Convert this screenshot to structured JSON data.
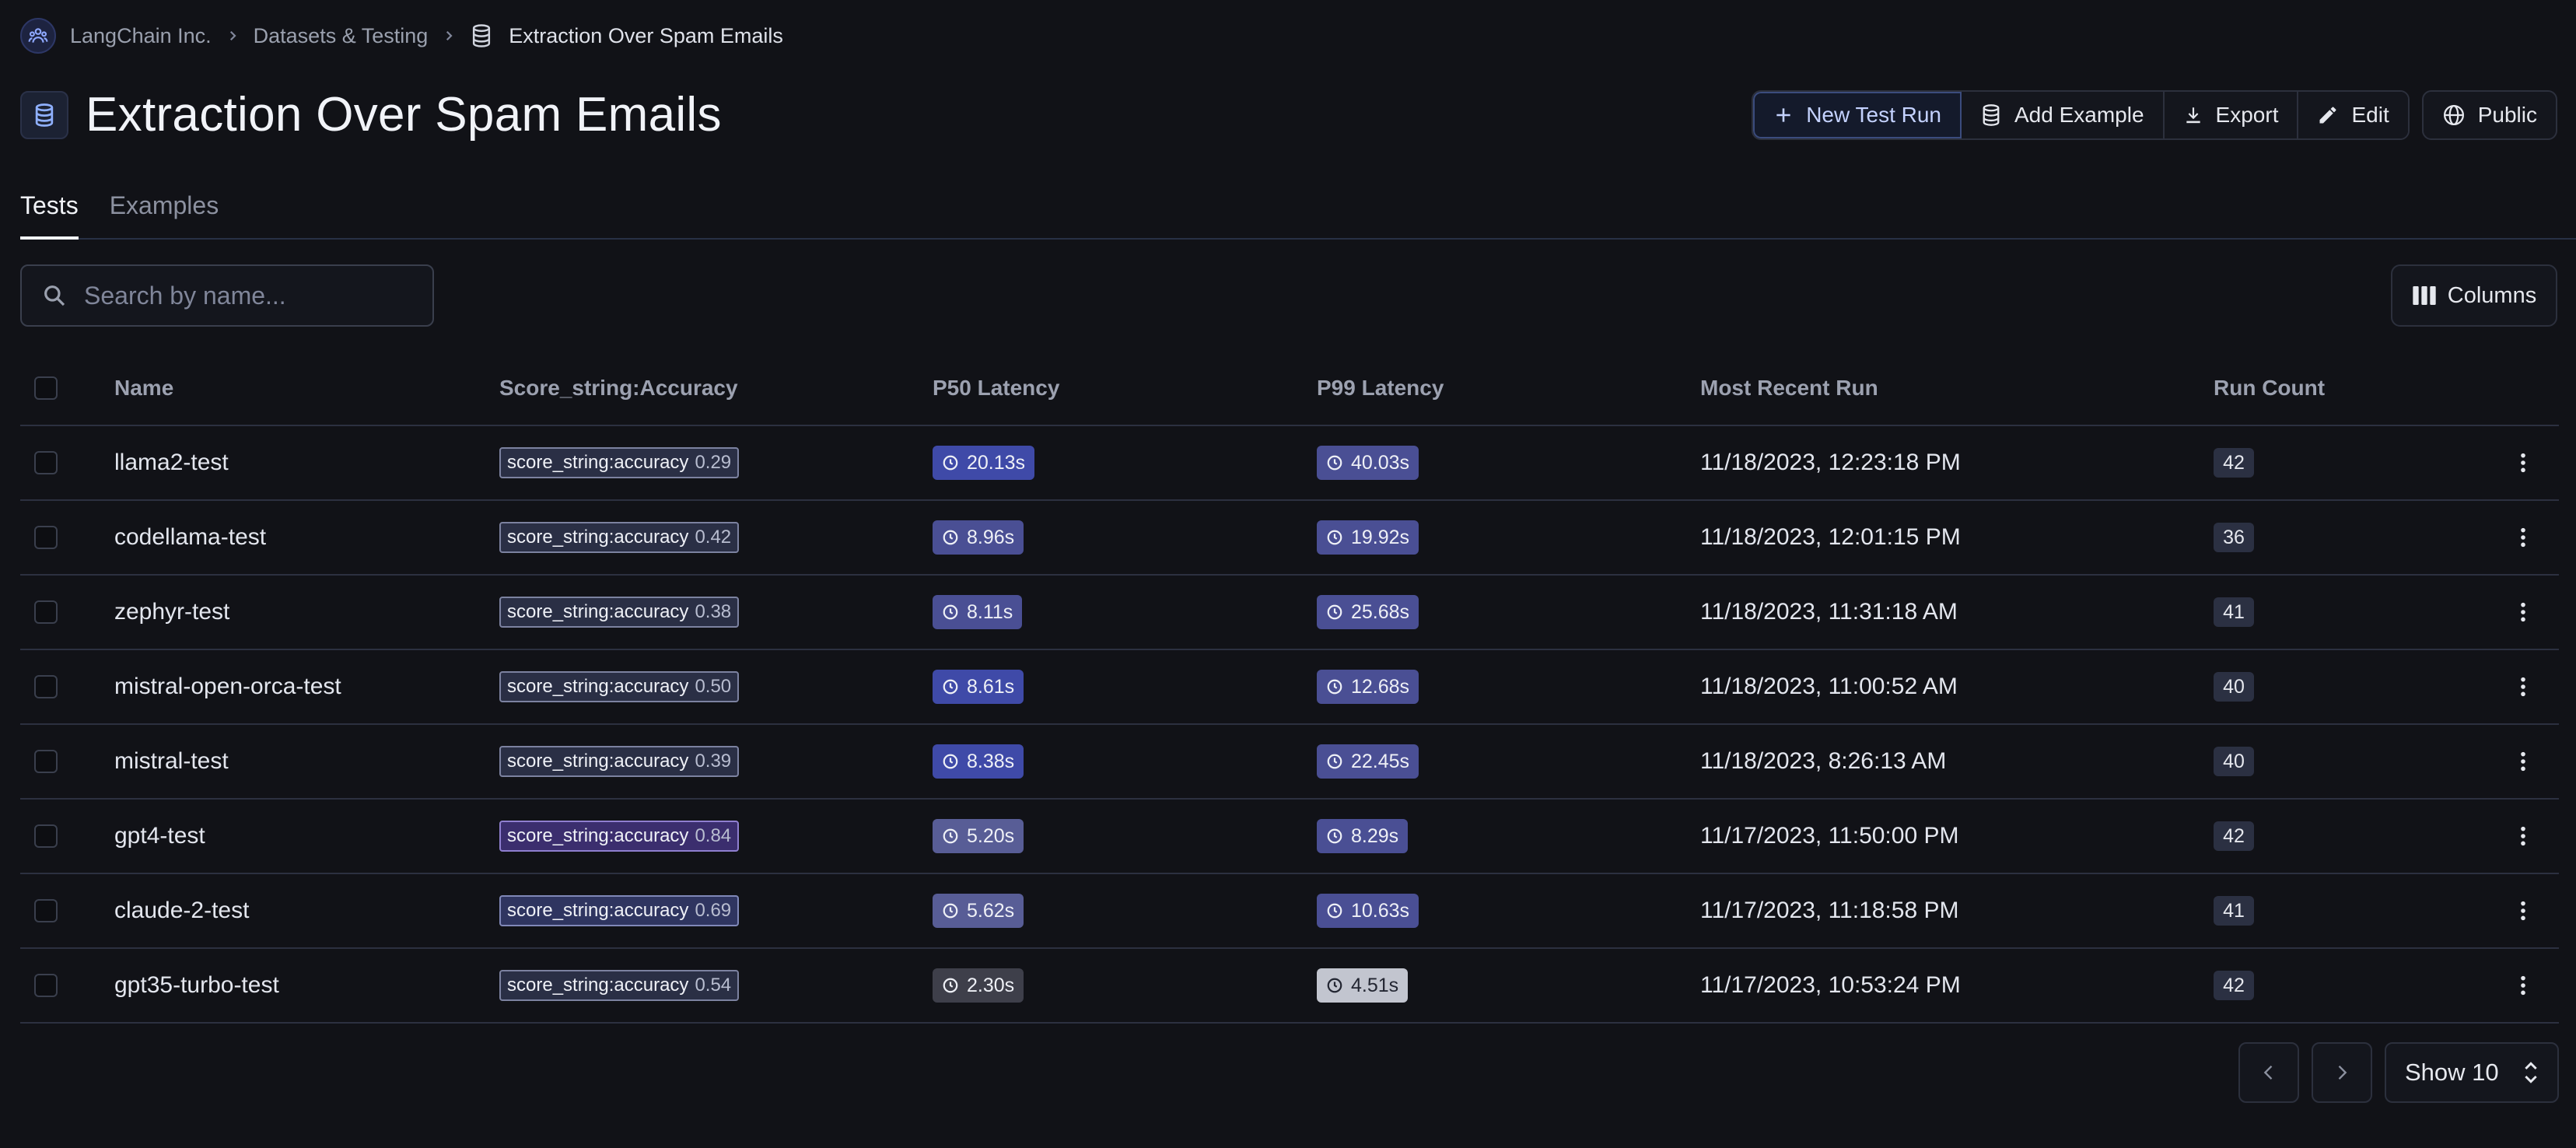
{
  "breadcrumb": {
    "org": "LangChain Inc.",
    "section": "Datasets & Testing",
    "current": "Extraction Over Spam Emails",
    "separator": "›"
  },
  "title": "Extraction Over Spam Emails",
  "actions": {
    "new_test_run": "New Test Run",
    "add_example": "Add Example",
    "export": "Export",
    "edit": "Edit",
    "public": "Public"
  },
  "tabs": [
    "Tests",
    "Examples"
  ],
  "search": {
    "placeholder": "Search by name..."
  },
  "columns_button": "Columns",
  "table": {
    "headers": {
      "name": "Name",
      "score": "Score_string:Accuracy",
      "p50": "P50 Latency",
      "p99": "P99 Latency",
      "recent": "Most Recent Run",
      "count": "Run Count"
    },
    "rows": [
      {
        "name": "llama2-test",
        "score_label": "score_string:accuracy",
        "score": "0.29",
        "p50": "20.13s",
        "p99": "40.03s",
        "recent": "11/18/2023, 12:23:18 PM",
        "count": "42"
      },
      {
        "name": "codellama-test",
        "score_label": "score_string:accuracy",
        "score": "0.42",
        "p50": "8.96s",
        "p99": "19.92s",
        "recent": "11/18/2023, 12:01:15 PM",
        "count": "36"
      },
      {
        "name": "zephyr-test",
        "score_label": "score_string:accuracy",
        "score": "0.38",
        "p50": "8.11s",
        "p99": "25.68s",
        "recent": "11/18/2023, 11:31:18 AM",
        "count": "41"
      },
      {
        "name": "mistral-open-orca-test",
        "score_label": "score_string:accuracy",
        "score": "0.50",
        "p50": "8.61s",
        "p99": "12.68s",
        "recent": "11/18/2023, 11:00:52 AM",
        "count": "40"
      },
      {
        "name": "mistral-test",
        "score_label": "score_string:accuracy",
        "score": "0.39",
        "p50": "8.38s",
        "p99": "22.45s",
        "recent": "11/18/2023, 8:26:13 AM",
        "count": "40"
      },
      {
        "name": "gpt4-test",
        "score_label": "score_string:accuracy",
        "score": "0.84",
        "p50": "5.20s",
        "p99": "8.29s",
        "recent": "11/17/2023, 11:50:00 PM",
        "count": "42"
      },
      {
        "name": "claude-2-test",
        "score_label": "score_string:accuracy",
        "score": "0.69",
        "p50": "5.62s",
        "p99": "10.63s",
        "recent": "11/17/2023, 11:18:58 PM",
        "count": "41"
      },
      {
        "name": "gpt35-turbo-test",
        "score_label": "score_string:accuracy",
        "score": "0.54",
        "p50": "2.30s",
        "p99": "4.51s",
        "recent": "11/17/2023, 10:53:24 PM",
        "count": "42"
      }
    ]
  },
  "pagination": {
    "show_label": "Show 10"
  },
  "colors": {
    "background": "#111217",
    "accent": "#c4d2ff",
    "latency_badge": "#40468a",
    "score_badge_high": "#3b2e6e"
  }
}
